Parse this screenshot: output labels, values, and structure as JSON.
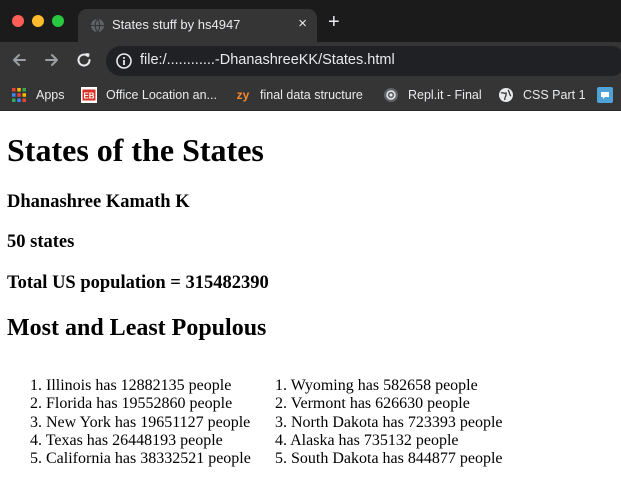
{
  "browser": {
    "tab": {
      "title": "States stuff by hs4947",
      "close_glyph": "×"
    },
    "new_tab_glyph": "+",
    "address": {
      "url": "file:/............-DhanashreeKK/States.html"
    },
    "bookmarks": [
      {
        "label": "Apps",
        "icon": "apps-grid-icon"
      },
      {
        "label": "Office Location an...",
        "icon": "eb-logo-icon"
      },
      {
        "label": "final data structure",
        "icon": "zy-logo-icon"
      },
      {
        "label": "Repl.it - Final",
        "icon": "replit-logo-icon"
      },
      {
        "label": "CSS Part 1",
        "icon": "globe-icon"
      }
    ],
    "colors": {
      "tabstrip": "#1b1b1b",
      "toolbar": "#353535",
      "omnibox": "#202124",
      "text": "#e8eaed"
    }
  },
  "page": {
    "title": "States of the States",
    "author": "Dhanashree Kamath K",
    "state_count": "50 states",
    "total_population": "Total US population = 315482390",
    "section_heading": "Most and Least Populous",
    "most_populous": [
      "1. Illinois has 12882135 people",
      "2. Florida has 19552860 people",
      "3. New York has 19651127 people",
      "4. Texas has 26448193 people",
      "5. California has 38332521 people"
    ],
    "least_populous": [
      "1. Wyoming has 582658 people",
      "2. Vermont has 626630 people",
      "3. North Dakota has 723393 people",
      "4. Alaska has 735132 people",
      "5. South Dakota has 844877 people"
    ]
  }
}
